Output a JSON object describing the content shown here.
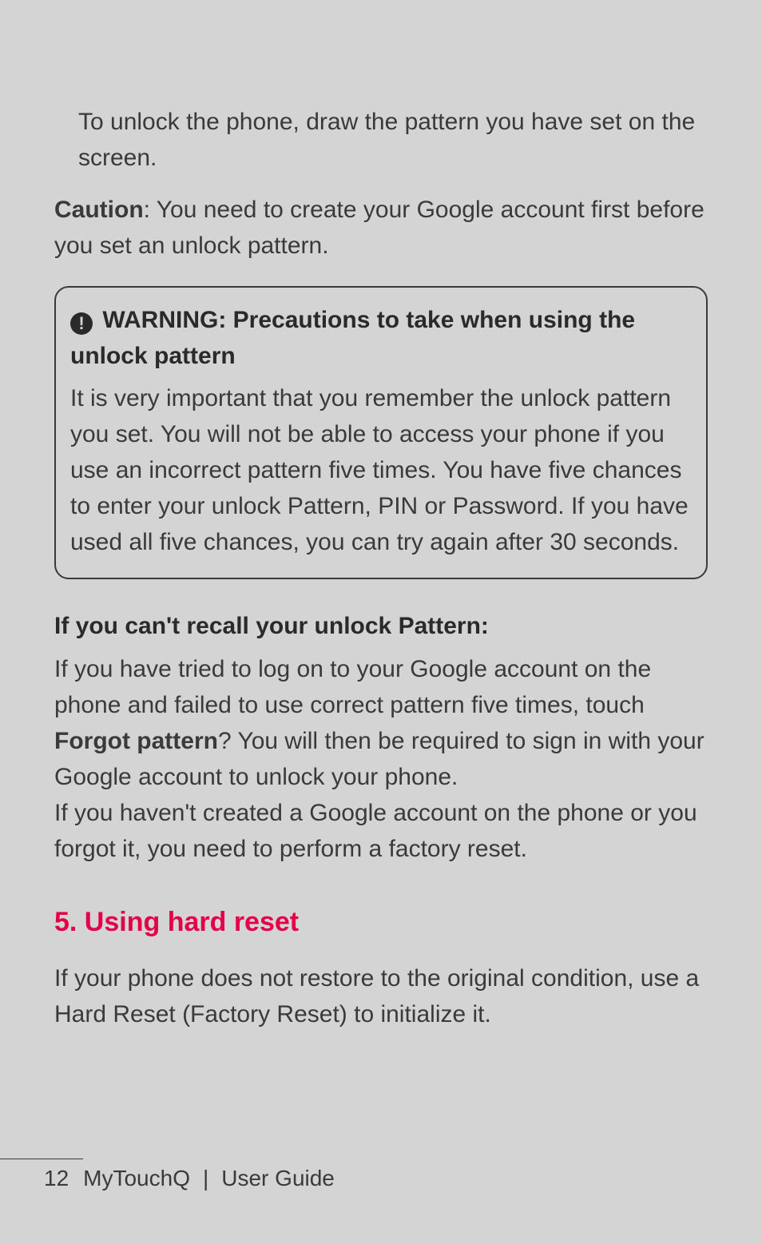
{
  "intro": "To unlock the phone, draw the pattern you have set on the screen.",
  "caution": {
    "label": "Caution",
    "text": ": You need to create your Google account first before you set an unlock pattern."
  },
  "warning": {
    "icon_glyph": "!",
    "title_prefix": "WARNING",
    "title_rest": ": Precautions to take when using the unlock pattern",
    "body": "It is very important that you remember the unlock pattern you set. You will not be able to access your phone if you use an incorrect pattern five times. You have five chances to enter your unlock Pattern, PIN or Password. If you have used all five chances, you can try again after 30 seconds."
  },
  "recall": {
    "heading": "If you can't recall your unlock Pattern:",
    "para1_a": "If you have tried to log on to your Google account on the phone and failed to use correct pattern five times, touch ",
    "forgot_label": "Forgot pattern",
    "para1_b": "? You will then be required to sign in with your Google account to unlock your phone.",
    "para2": "If you haven't created a Google account on the phone or you forgot it, you need to perform a factory reset."
  },
  "section5": {
    "heading": "5. Using hard reset",
    "body": "If your phone does not restore to the original condition, use a Hard Reset (Factory Reset) to initialize it."
  },
  "footer": {
    "page": "12",
    "product": "MyTouchQ",
    "divider": "|",
    "doc": "User Guide"
  }
}
